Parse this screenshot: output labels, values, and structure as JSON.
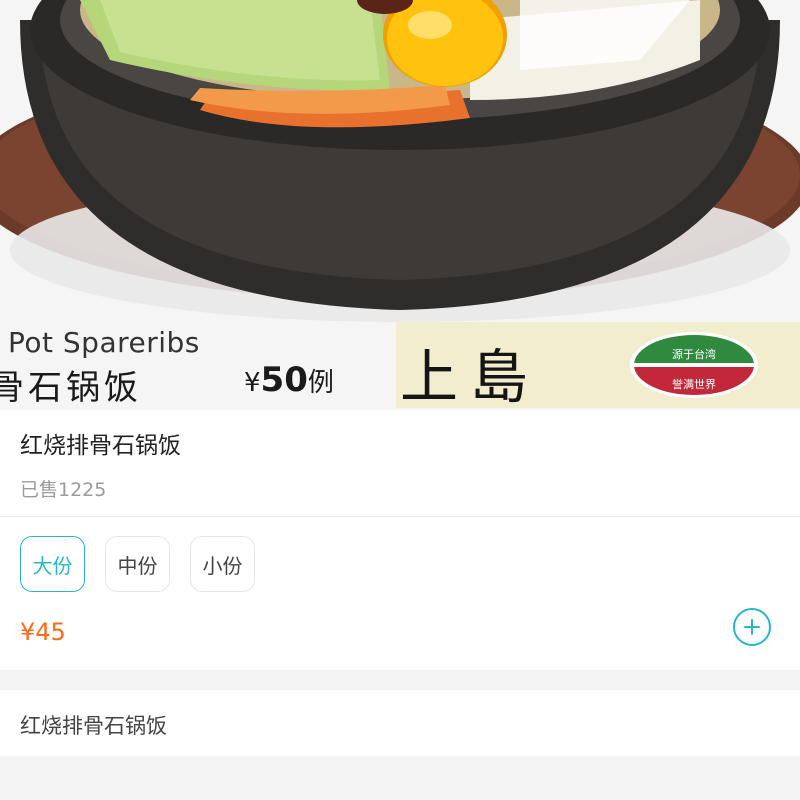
{
  "hero": {
    "banner": {
      "english_text": "Pot Spareribs",
      "chinese_text": "骨石锅饭",
      "price_symbol": "¥",
      "price_value": "50",
      "price_unit": "例",
      "brand_name": "上島",
      "seal_top": "源于台湾",
      "seal_bottom": "誉满世界"
    }
  },
  "product": {
    "title": "红烧排骨石锅饭",
    "sold": "已售1225",
    "specs": [
      {
        "label": "大份",
        "selected": true
      },
      {
        "label": "中份",
        "selected": false
      },
      {
        "label": "小份",
        "selected": false
      }
    ],
    "price": "¥45"
  },
  "description": {
    "text": "红烧排骨石锅饭"
  },
  "colors": {
    "accent": "#26b8c5",
    "price": "#ff6a1a",
    "brand_bg": "#f2edcf"
  },
  "icons": {
    "add": "plus-circle-icon"
  }
}
